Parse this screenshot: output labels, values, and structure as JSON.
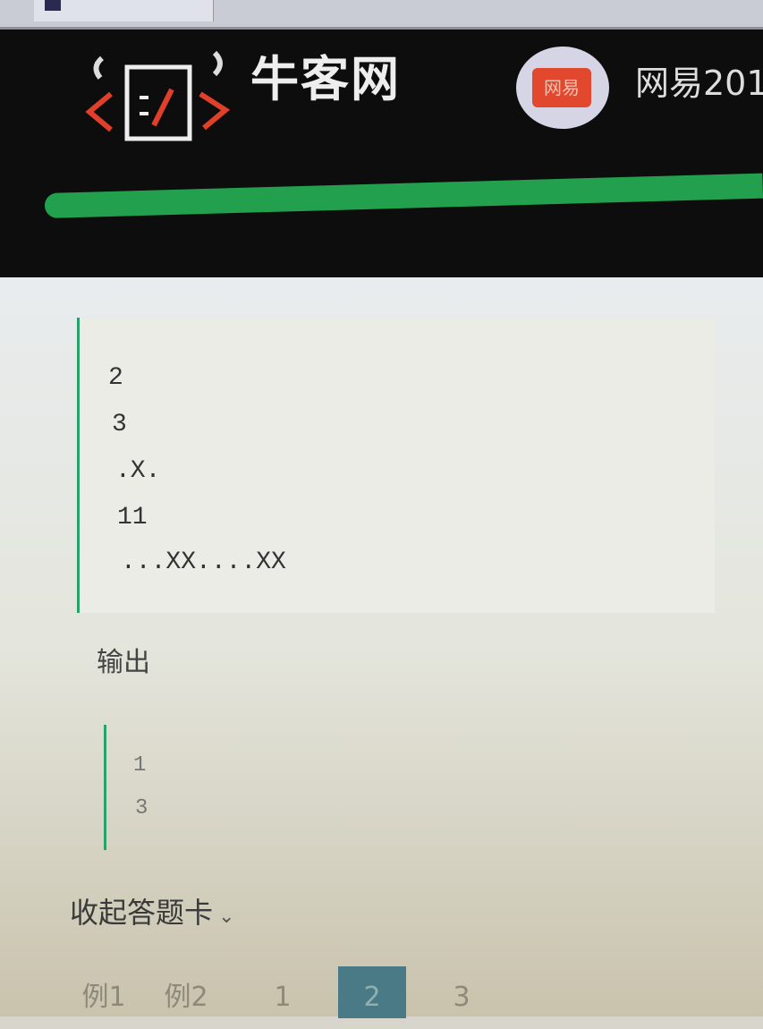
{
  "header": {
    "brand": "牛客网",
    "company_badge": "网易",
    "company_name": "网易201",
    "progress_percent": 100
  },
  "input_sample": {
    "lines": [
      "2",
      "3",
      ".X.",
      "11",
      "...XX....XX"
    ]
  },
  "output_label": "输出",
  "output_sample": {
    "lines": [
      "1",
      "3"
    ]
  },
  "answer_card": {
    "toggle_label": "收起答题卡",
    "chevron": "⌄"
  },
  "pager": {
    "items": [
      "例1",
      "例2",
      "1",
      "2",
      "3"
    ],
    "active": "2"
  },
  "colors": {
    "accent": "#23a04e",
    "active_page": "#4a7a86"
  }
}
